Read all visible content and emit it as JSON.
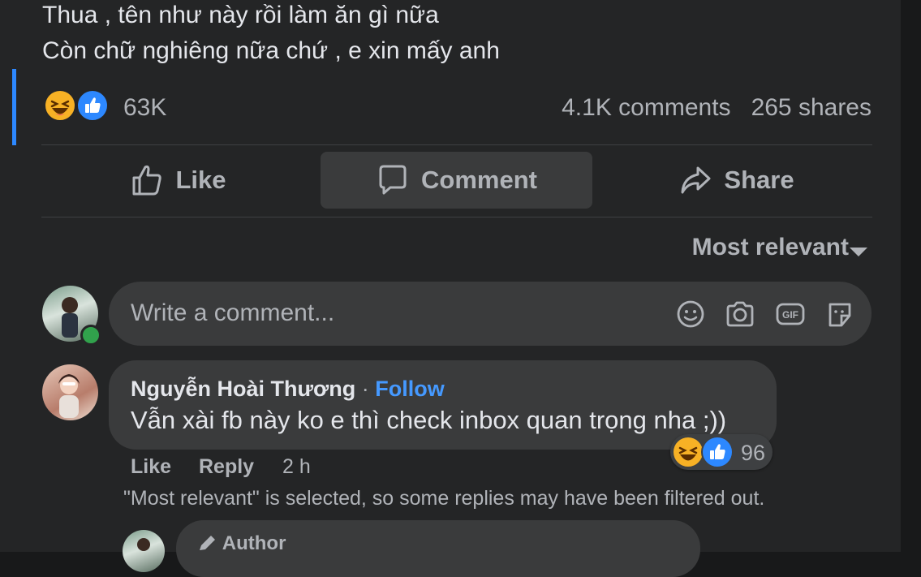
{
  "post": {
    "text_line_1": "Thua , tên như này rồi làm ăn gì nữa",
    "text_line_2": "Còn chữ nghiêng nữa chứ , e xin mấy anh",
    "reaction_count": "63K",
    "comments_count": "4.1K comments",
    "shares_count": "265 shares",
    "reaction_icons": [
      "haha-icon",
      "like-icon"
    ]
  },
  "actions": {
    "like_label": "Like",
    "comment_label": "Comment",
    "share_label": "Share"
  },
  "sort": {
    "label": "Most relevant"
  },
  "composer": {
    "placeholder": "Write a comment...",
    "icons": [
      "emoji-icon",
      "camera-icon",
      "gif-icon",
      "sticker-icon"
    ]
  },
  "comments": [
    {
      "author": "Nguyễn Hoài Thương",
      "separator": "·",
      "follow_label": "Follow",
      "text": "Vẫn xài fb này ko e thì check inbox quan trọng nha ;))",
      "reaction_count": "96",
      "like_label": "Like",
      "reply_label": "Reply",
      "time": "2 h"
    }
  ],
  "filtered_notice": "\"Most relevant\" is selected, so some replies may have been filtered out.",
  "reply": {
    "badge_label": "Author"
  },
  "colors": {
    "background": "#242526",
    "surface": "#3a3b3c",
    "text_primary": "#e4e6eb",
    "text_secondary": "#b0b3b8",
    "accent": "#2d88ff",
    "follow": "#4599ff",
    "online": "#31a24c"
  }
}
